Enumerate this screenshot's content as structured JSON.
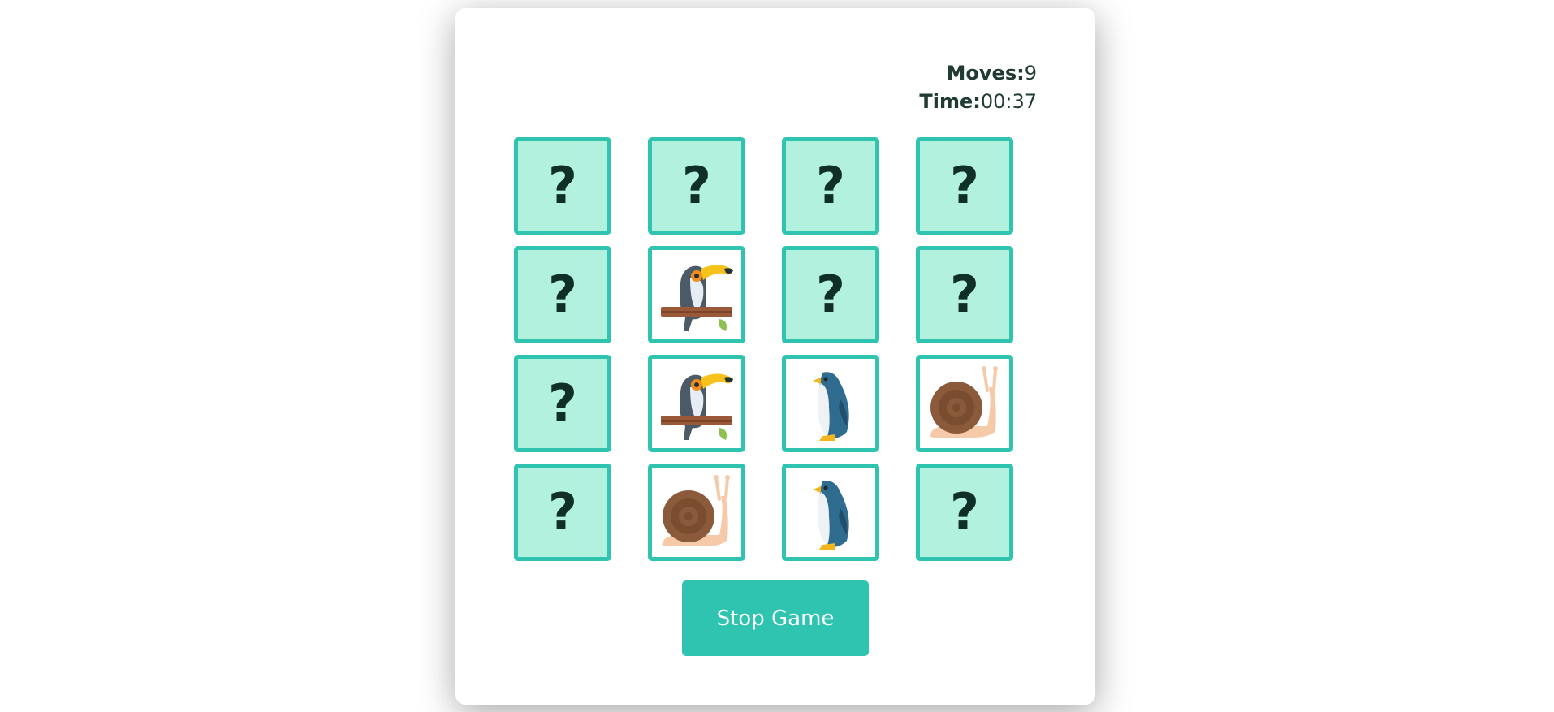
{
  "stats": {
    "moves_label": "Moves:",
    "moves_value": "9",
    "time_label": "Time:",
    "time_value": "00:37"
  },
  "cards": [
    {
      "state": "hidden",
      "face": "?"
    },
    {
      "state": "hidden",
      "face": "?"
    },
    {
      "state": "hidden",
      "face": "?"
    },
    {
      "state": "hidden",
      "face": "?"
    },
    {
      "state": "hidden",
      "face": "?"
    },
    {
      "state": "flipped",
      "animal": "toucan"
    },
    {
      "state": "hidden",
      "face": "?"
    },
    {
      "state": "hidden",
      "face": "?"
    },
    {
      "state": "hidden",
      "face": "?"
    },
    {
      "state": "flipped",
      "animal": "toucan"
    },
    {
      "state": "flipped",
      "animal": "penguin"
    },
    {
      "state": "flipped",
      "animal": "snail"
    },
    {
      "state": "hidden",
      "face": "?"
    },
    {
      "state": "flipped",
      "animal": "snail"
    },
    {
      "state": "flipped",
      "animal": "penguin"
    },
    {
      "state": "hidden",
      "face": "?"
    }
  ],
  "stop_button": {
    "label": "Stop Game"
  },
  "colors": {
    "accent": "#2ec4b0",
    "card_back": "#b2f1de",
    "text_dark": "#1f3b34"
  }
}
